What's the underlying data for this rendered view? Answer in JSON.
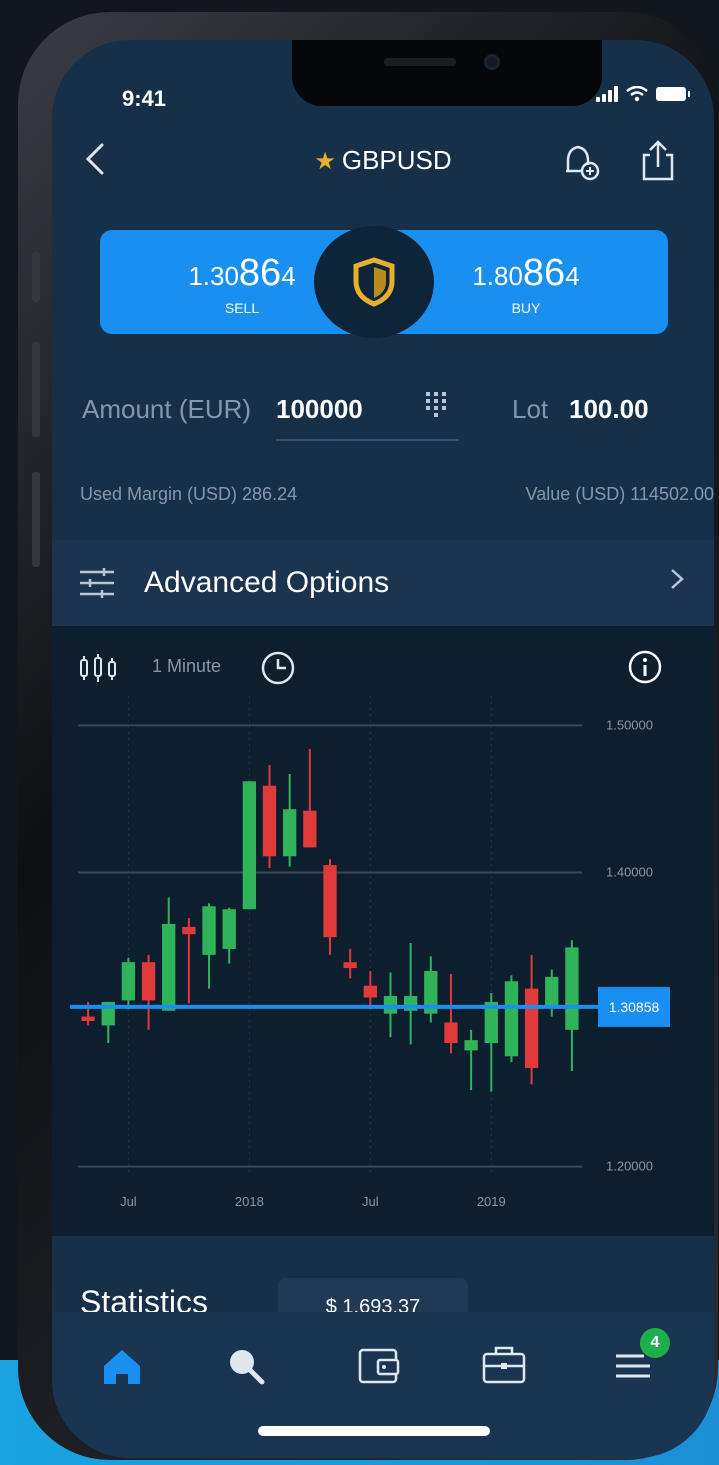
{
  "status_bar": {
    "time": "9:41"
  },
  "header": {
    "symbol": "GBPUSD",
    "icons": [
      "back-icon",
      "star-icon",
      "price-alert-icon",
      "share-icon"
    ]
  },
  "trade": {
    "sell": {
      "price_prefix": "1.30",
      "price_big": "86",
      "price_suffix": "4",
      "label": "SELL"
    },
    "buy": {
      "price_prefix": "1.80",
      "price_big": "86",
      "price_suffix": "4",
      "label": "BUY"
    },
    "shield_icon": "shield-icon"
  },
  "order": {
    "amount_label": "Amount (EUR)",
    "amount_value": "100000",
    "lot_label": "Lot",
    "lot_value": "100.00"
  },
  "margin": {
    "used_margin": "Used Margin (USD) 286.24",
    "value": "Value (USD) 114502.00"
  },
  "advanced_options": {
    "label": "Advanced Options"
  },
  "chart_toolbar": {
    "timeframe": "1 Minute"
  },
  "chart_data": {
    "type": "candlestick",
    "ylim": [
      1.18,
      1.52
    ],
    "y_ticks": [
      "1.50000",
      "1.40000",
      "1.20000"
    ],
    "x_ticks": [
      "Jul",
      "2018",
      "Jul",
      "2019"
    ],
    "current_price": "1.30858",
    "candles": [
      {
        "o": 1.302,
        "h": 1.312,
        "l": 1.296,
        "c": 1.299
      },
      {
        "o": 1.296,
        "h": 1.312,
        "l": 1.284,
        "c": 1.312
      },
      {
        "o": 1.313,
        "h": 1.342,
        "l": 1.307,
        "c": 1.339
      },
      {
        "o": 1.339,
        "h": 1.344,
        "l": 1.293,
        "c": 1.313
      },
      {
        "o": 1.306,
        "h": 1.383,
        "l": 1.306,
        "c": 1.365
      },
      {
        "o": 1.363,
        "h": 1.369,
        "l": 1.311,
        "c": 1.358
      },
      {
        "o": 1.344,
        "h": 1.379,
        "l": 1.321,
        "c": 1.377
      },
      {
        "o": 1.348,
        "h": 1.376,
        "l": 1.338,
        "c": 1.375
      },
      {
        "o": 1.375,
        "h": 1.462,
        "l": 1.375,
        "c": 1.462
      },
      {
        "o": 1.459,
        "h": 1.473,
        "l": 1.403,
        "c": 1.411
      },
      {
        "o": 1.411,
        "h": 1.467,
        "l": 1.404,
        "c": 1.443
      },
      {
        "o": 1.442,
        "h": 1.484,
        "l": 1.417,
        "c": 1.417
      },
      {
        "o": 1.405,
        "h": 1.409,
        "l": 1.344,
        "c": 1.356
      },
      {
        "o": 1.339,
        "h": 1.348,
        "l": 1.328,
        "c": 1.335
      },
      {
        "o": 1.323,
        "h": 1.333,
        "l": 1.307,
        "c": 1.315
      },
      {
        "o": 1.304,
        "h": 1.332,
        "l": 1.288,
        "c": 1.316
      },
      {
        "o": 1.306,
        "h": 1.352,
        "l": 1.283,
        "c": 1.316
      },
      {
        "o": 1.304,
        "h": 1.343,
        "l": 1.298,
        "c": 1.333
      },
      {
        "o": 1.298,
        "h": 1.331,
        "l": 1.277,
        "c": 1.284
      },
      {
        "o": 1.279,
        "h": 1.293,
        "l": 1.252,
        "c": 1.286
      },
      {
        "o": 1.284,
        "h": 1.318,
        "l": 1.251,
        "c": 1.312
      },
      {
        "o": 1.275,
        "h": 1.33,
        "l": 1.271,
        "c": 1.326
      },
      {
        "o": 1.321,
        "h": 1.344,
        "l": 1.256,
        "c": 1.267
      },
      {
        "o": 1.309,
        "h": 1.334,
        "l": 1.302,
        "c": 1.329
      },
      {
        "o": 1.293,
        "h": 1.354,
        "l": 1.265,
        "c": 1.349
      }
    ]
  },
  "statistics": {
    "title": "Statistics",
    "balance": "$ 1,693.37"
  },
  "tabbar": {
    "tabs": [
      "home-icon",
      "search-icon",
      "wallet-icon",
      "portfolio-icon",
      "menu-icon"
    ],
    "menu_badge": "4",
    "accent": "#1a8ff2"
  },
  "colors": {
    "up": "#2fb45a",
    "down": "#e03a3a",
    "price_line": "#1a8ff2"
  }
}
